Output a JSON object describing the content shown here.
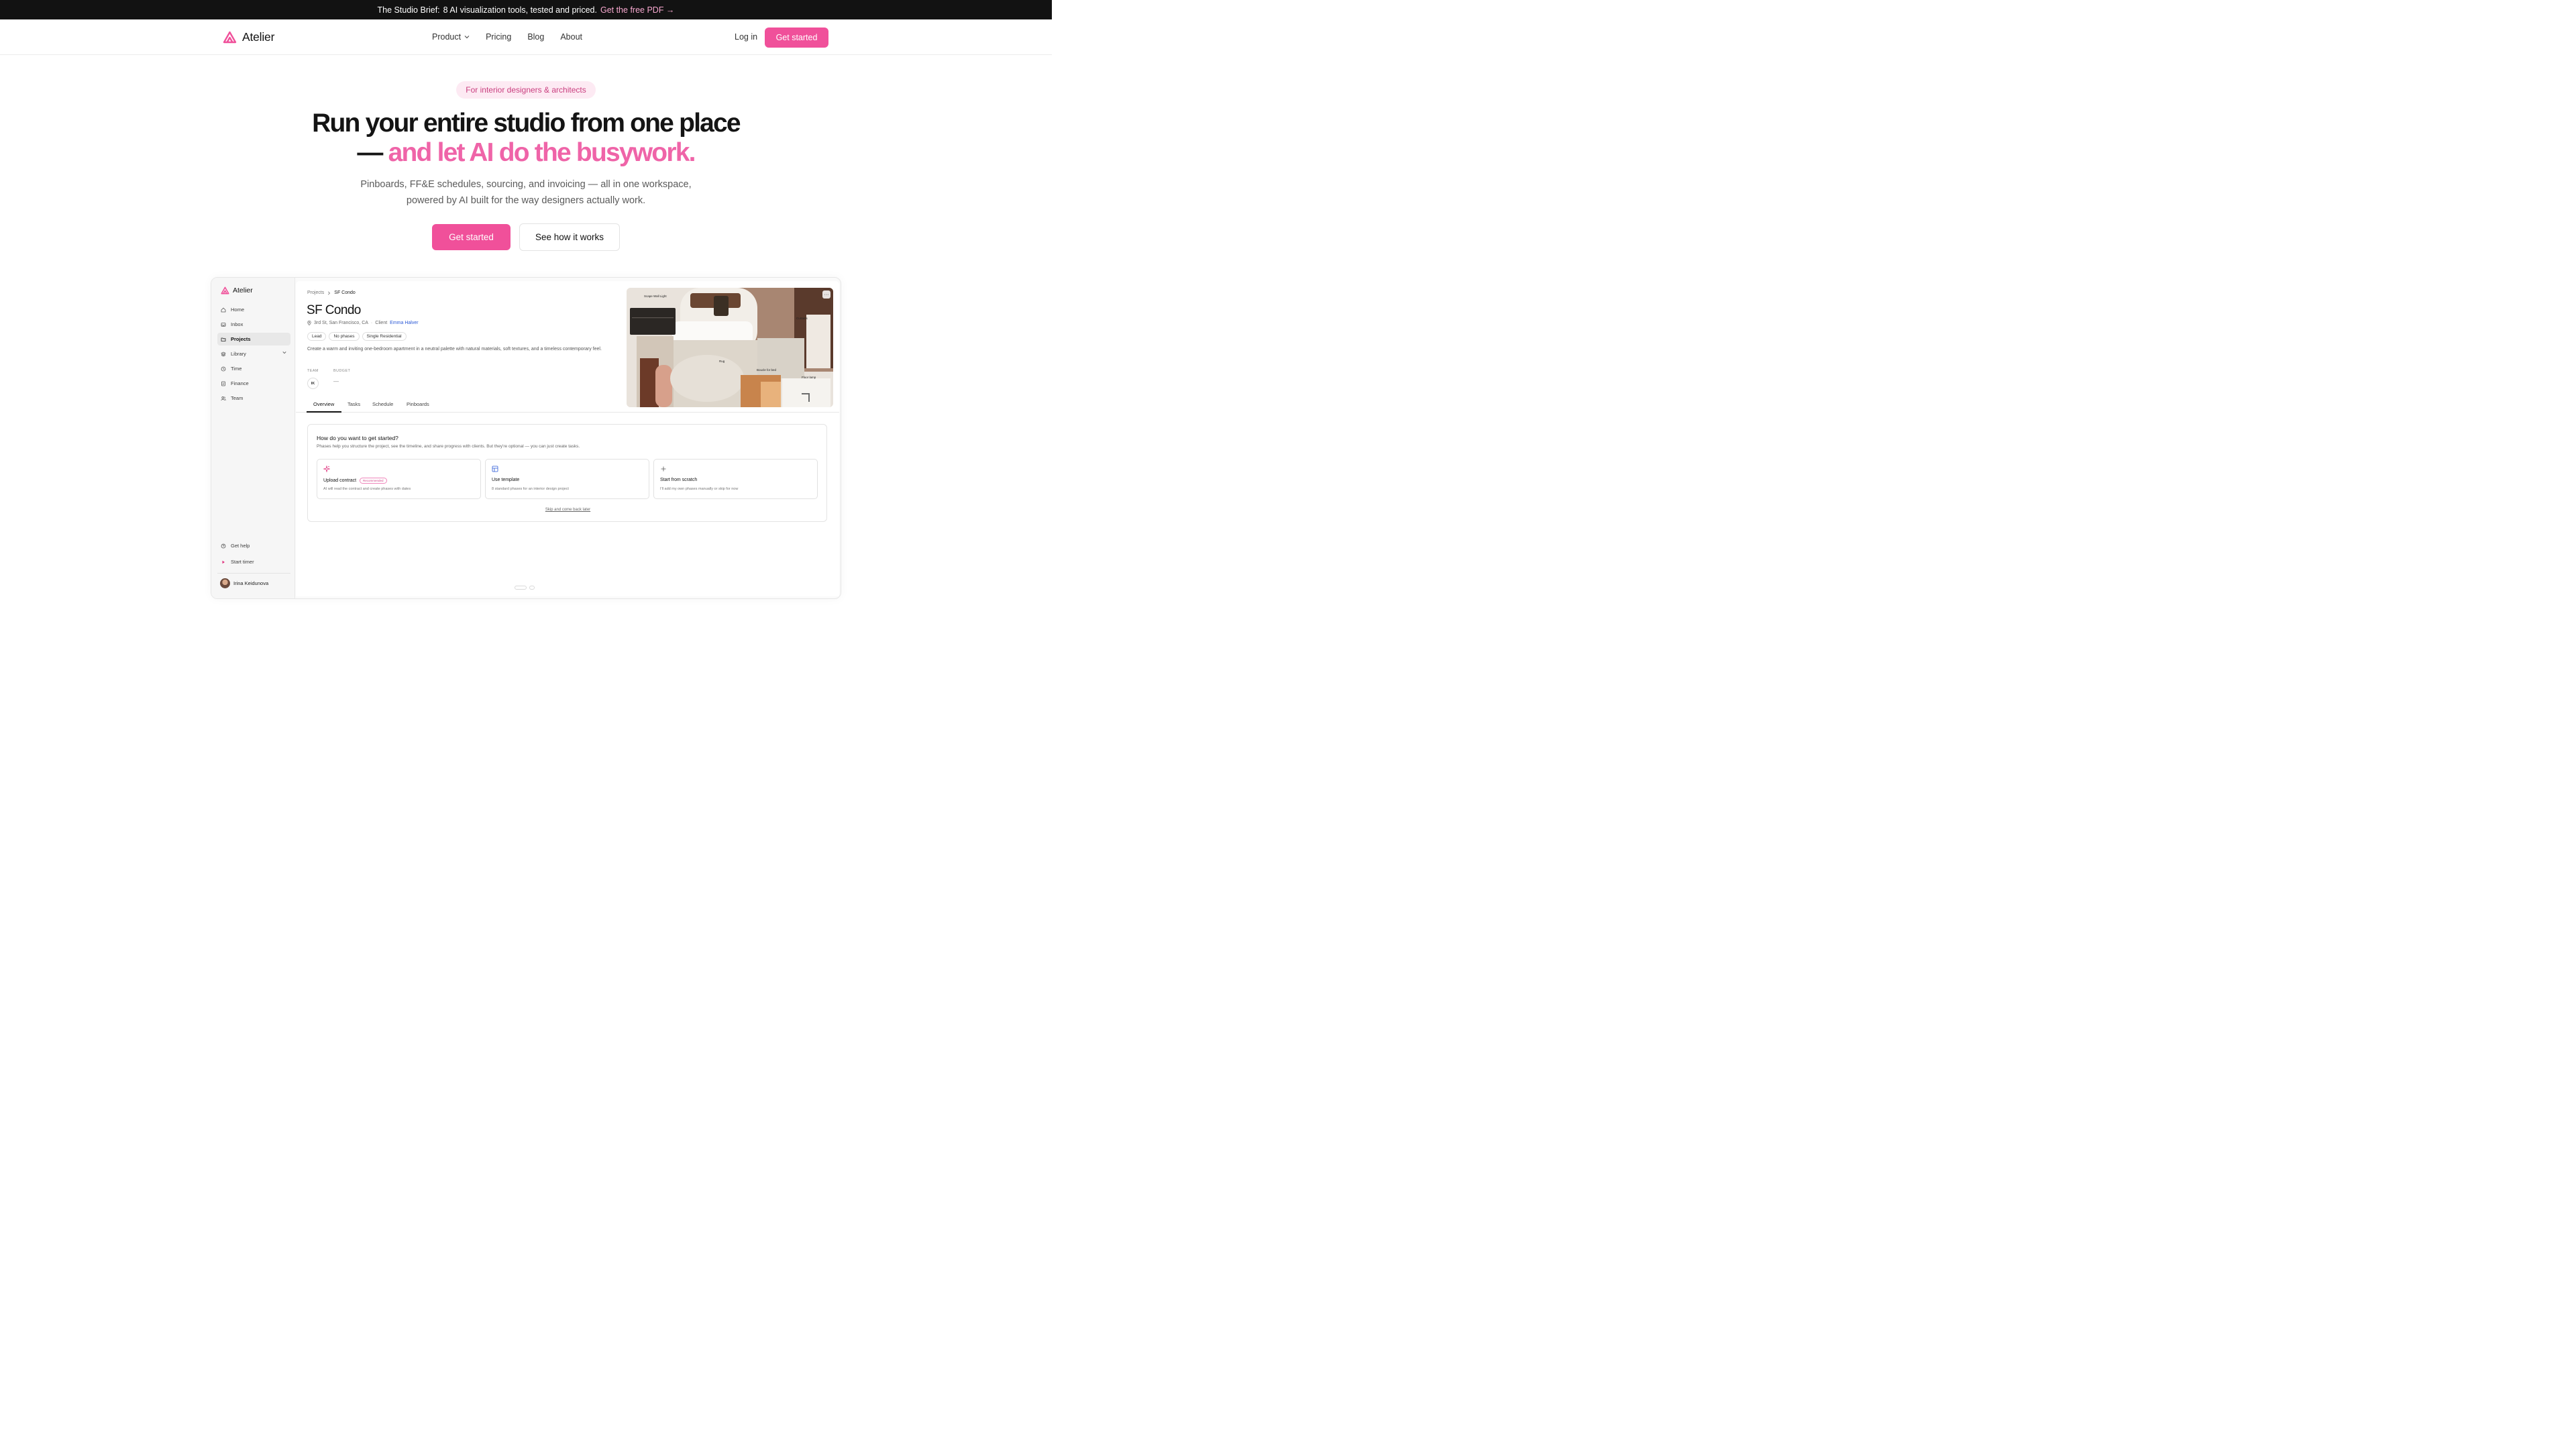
{
  "announcement": {
    "lead": "The Studio Brief:",
    "text": "8 AI visualization tools, tested and priced.",
    "link": "Get the free PDF →"
  },
  "header": {
    "brand": "Atelier",
    "nav": [
      "Product",
      "Pricing",
      "Blog",
      "About"
    ],
    "login": "Log in",
    "cta": "Get started"
  },
  "hero": {
    "pill": "For interior designers & architects",
    "title_line1": "Run your entire studio from one place",
    "title_dash": "—",
    "title_accent": "and let AI do the busywork.",
    "subtitle_line1": "Pinboards, FF&E schedules, sourcing, and invoicing — all in one workspace,",
    "subtitle_line2": "powered by AI built for the way designers actually work.",
    "primary_cta": "Get started",
    "secondary_cta": "See how it works"
  },
  "app": {
    "brand": "Atelier",
    "sidebar": {
      "items": [
        {
          "label": "Home",
          "icon": "home-icon"
        },
        {
          "label": "Inbox",
          "icon": "inbox-icon"
        },
        {
          "label": "Projects",
          "icon": "folder-icon",
          "active": true
        },
        {
          "label": "Library",
          "icon": "library-icon"
        },
        {
          "label": "Time",
          "icon": "clock-icon"
        },
        {
          "label": "Finance",
          "icon": "finance-icon"
        },
        {
          "label": "Team",
          "icon": "team-icon"
        }
      ],
      "help": "Get help",
      "timer": "Start timer",
      "user": "Irina Keidunova"
    },
    "breadcrumb": {
      "parent": "Projects",
      "current": "SF Condo"
    },
    "project": {
      "title": "SF Condo",
      "address": "3rd St, San Francisco, CA",
      "client_label": "Client",
      "client": "Emma Halver",
      "tags": [
        "Lead",
        "No phases",
        "Single Residential"
      ],
      "description": "Create a warm and inviting one-bedroom apartment in a neutral palette with natural materials, soft textures, and a timeless contemporary feel.",
      "team_label": "TEAM",
      "budget_label": "BUDGET",
      "team_initials": "IK",
      "budget_value": "—"
    },
    "tabs": [
      "Overview",
      "Tasks",
      "Schedule",
      "Pinboards"
    ],
    "moodboard": {
      "labels": [
        "Scape Wall Light",
        "Curtains",
        "Rug",
        "Boucle for bed",
        "Floor lamp"
      ],
      "more": "···"
    },
    "onboarding": {
      "title": "How do you want to get started?",
      "subtitle": "Phases help you structure the project, see the timeline, and share progress with clients. But they're optional — you can just create tasks.",
      "options": [
        {
          "title": "Upload contract",
          "badge": "Recommended",
          "desc": "AI will read the contract and create phases with dates",
          "icon": "sparkle-icon"
        },
        {
          "title": "Use template",
          "desc": "8 standard phases for an interior design project",
          "icon": "template-icon"
        },
        {
          "title": "Start from scratch",
          "desc": "I'll add my own phases manually or skip for now",
          "icon": "plus-icon"
        }
      ],
      "skip": "Skip and come back later"
    }
  },
  "colors": {
    "accent": "#f0509a",
    "accent_text": "#ef64a8",
    "dark_bar": "#121212"
  }
}
